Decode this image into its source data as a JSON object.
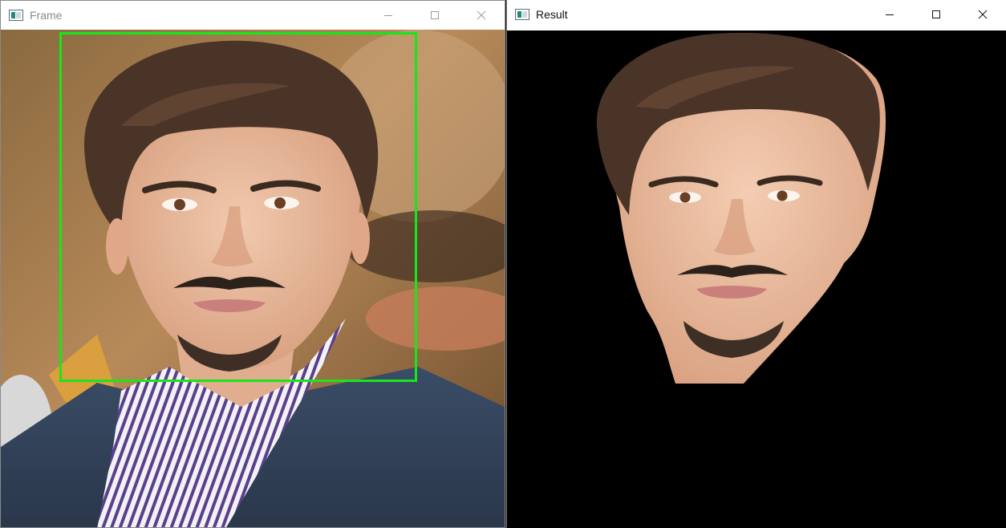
{
  "windows": {
    "frame": {
      "title": "Frame"
    },
    "result": {
      "title": "Result"
    }
  },
  "controls": {
    "minimize_icon": "minimize-icon",
    "maximize_icon": "maximize-icon",
    "close_icon": "close-icon"
  },
  "detection": {
    "box_color": "#19e619",
    "label": ""
  },
  "colors": {
    "result_background": "#000000",
    "title_active": "#111111",
    "title_inactive": "#8a8a8a"
  }
}
